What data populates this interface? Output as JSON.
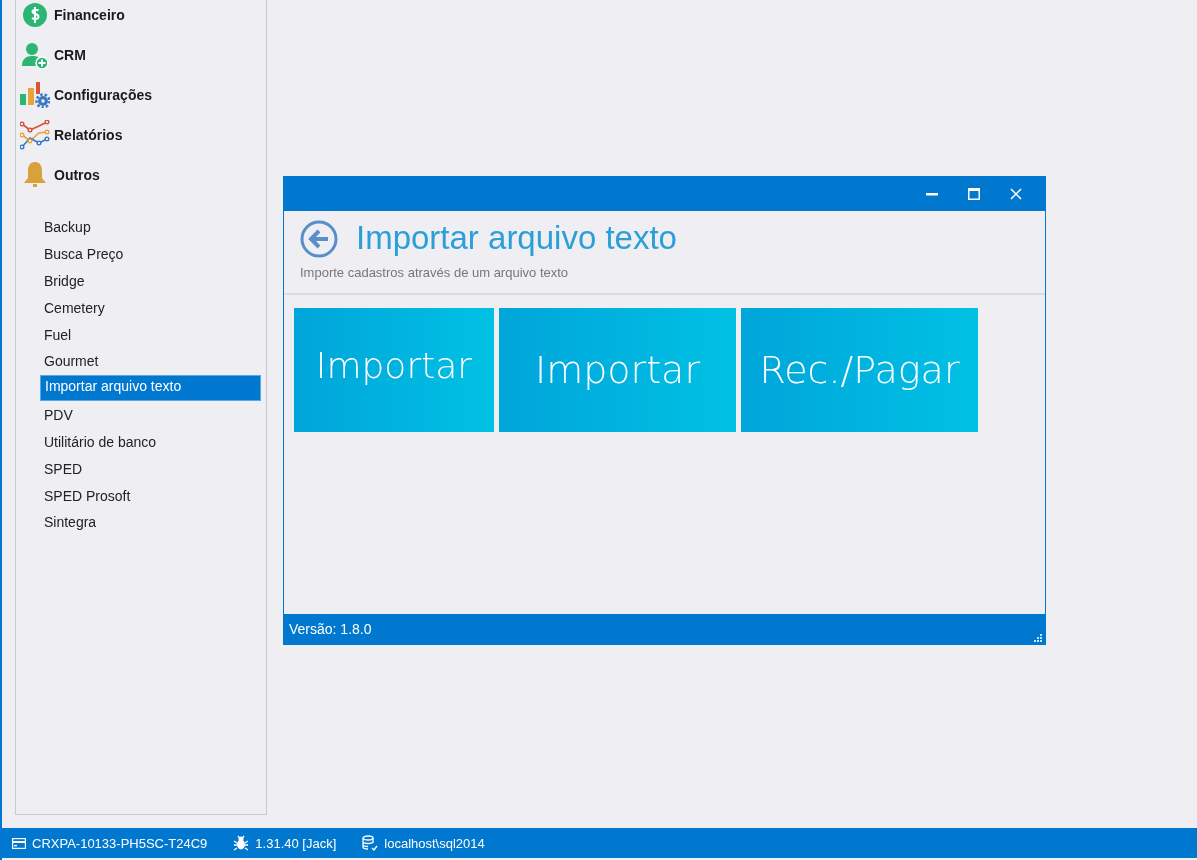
{
  "sidebar": {
    "categories": [
      {
        "label": "Financeiro"
      },
      {
        "label": "CRM"
      },
      {
        "label": "Configurações"
      },
      {
        "label": "Relatórios"
      },
      {
        "label": "Outros"
      }
    ],
    "items": [
      {
        "label": "Backup",
        "selected": false
      },
      {
        "label": "Busca Preço",
        "selected": false
      },
      {
        "label": "Bridge",
        "selected": false
      },
      {
        "label": "Cemetery",
        "selected": false
      },
      {
        "label": "Fuel",
        "selected": false
      },
      {
        "label": "Gourmet",
        "selected": false
      },
      {
        "label": "Importar arquivo texto",
        "selected": true
      },
      {
        "label": "PDV",
        "selected": false
      },
      {
        "label": "Utilitário de banco",
        "selected": false
      },
      {
        "label": "SPED",
        "selected": false
      },
      {
        "label": "SPED Prosoft",
        "selected": false
      },
      {
        "label": "Sintegra",
        "selected": false
      }
    ]
  },
  "dialog": {
    "title": "Importar arquivo texto",
    "subtitle": "Importe cadastros através de um arquivo texto",
    "tiles": [
      {
        "label": "Importar"
      },
      {
        "label": "Importar"
      },
      {
        "label": "Rec./Pagar"
      }
    ],
    "version": "Versão: 1.8.0"
  },
  "status_bar": [
    {
      "text": "CRXPA-10133-PH5SC-T24C9"
    },
    {
      "text": "1.31.40 [Jack]"
    },
    {
      "text": "localhost\\sql2014"
    }
  ]
}
